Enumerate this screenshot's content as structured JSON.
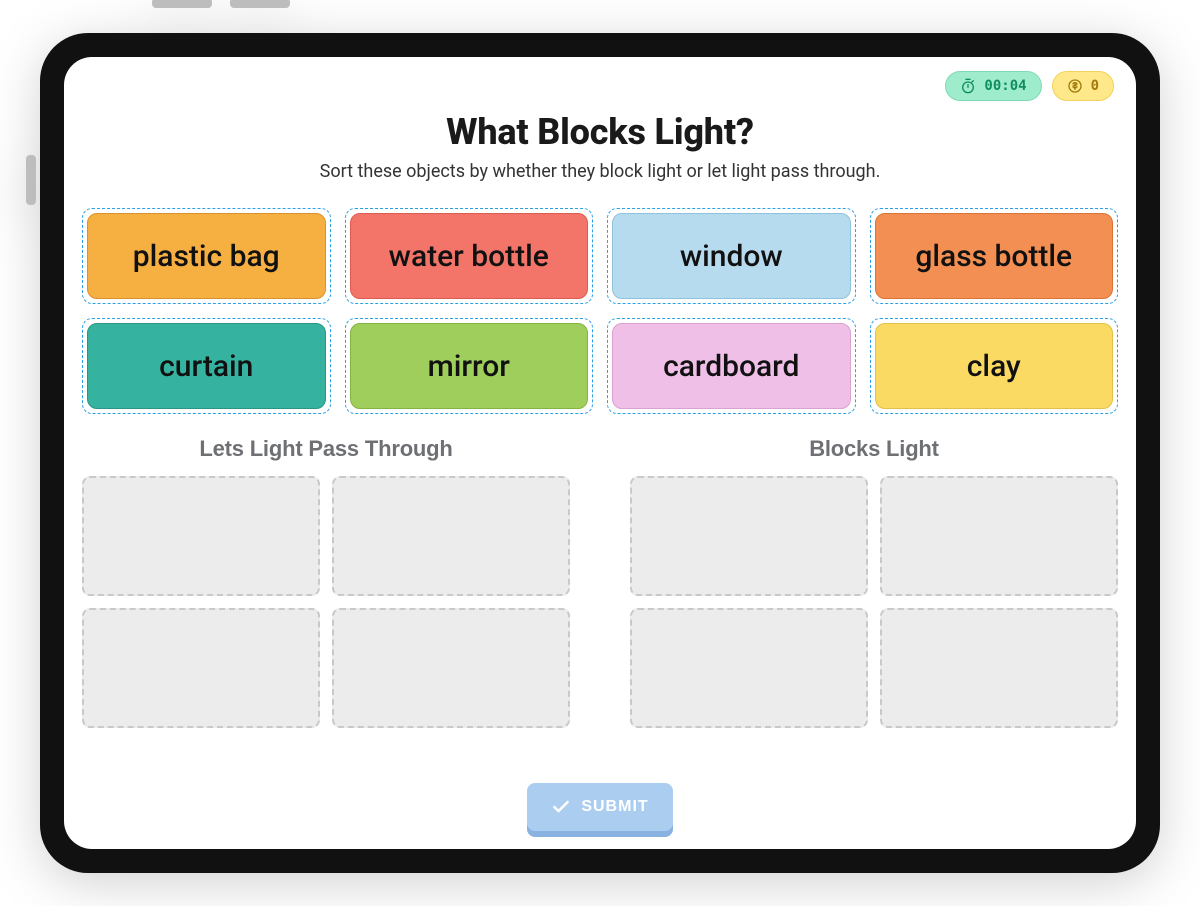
{
  "status": {
    "timer": "00:04",
    "coins": "0"
  },
  "header": {
    "title": "What Blocks Light?",
    "subtitle": "Sort these objects by whether they block light or let light pass through."
  },
  "tiles": [
    {
      "label": "plastic bag",
      "color": "c-orange"
    },
    {
      "label": "water bottle",
      "color": "c-red"
    },
    {
      "label": "window",
      "color": "c-blue"
    },
    {
      "label": "glass bottle",
      "color": "c-dorange"
    },
    {
      "label": "curtain",
      "color": "c-teal"
    },
    {
      "label": "mirror",
      "color": "c-green"
    },
    {
      "label": "cardboard",
      "color": "c-pink"
    },
    {
      "label": "clay",
      "color": "c-yellow"
    }
  ],
  "zones": {
    "left_title": "Lets Light Pass Through",
    "right_title": "Blocks Light"
  },
  "submit": {
    "label": "SUBMIT"
  }
}
